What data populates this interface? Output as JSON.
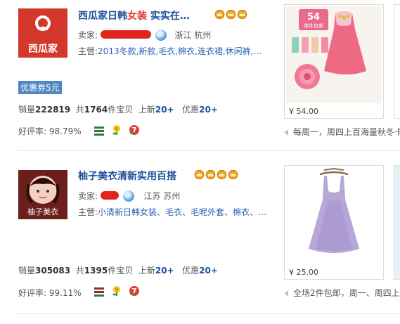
{
  "shops": [
    {
      "name_prefix": "西瓜家日韩",
      "name_highlight": "女装",
      "name_suffix": " 实实在…",
      "logo_text": "西瓜家",
      "crowns": 3,
      "seller_label": "卖家:",
      "location": "浙江 杭州",
      "main_label": "主营:",
      "main_items": "2013冬款,新款,毛衣,棉衣,连衣裙,休闲裤,…",
      "coupon": "优惠券5元",
      "sales_label": "销量",
      "sales_value": "222819",
      "total_prefix": "共",
      "total_value": "1764",
      "total_suffix": "件宝贝",
      "new_label": "上新",
      "new_value": "20+",
      "discount_label": "优惠",
      "discount_value": "20+",
      "rating_label": "好评率:",
      "rating_value": "98.79%",
      "product_price": "¥ 54.00",
      "product_badge_top": "54",
      "product_badge_unit": "元",
      "product_badge_bottom": "单件包邮",
      "notice": "每周一，周四上百海量秋冬卡"
    },
    {
      "name_prefix": "柚子美衣清新实用百搭",
      "name_highlight": "",
      "name_suffix": "",
      "logo_text": "柚子美衣",
      "crowns": 4,
      "seller_label": "卖家:",
      "location": "江苏 苏州",
      "main_label": "主营:",
      "main_items": "小清新日韩女装、毛衣、毛呢外套、棉衣、…",
      "sales_label": "销量",
      "sales_value": "305083",
      "total_prefix": "共",
      "total_value": "1395",
      "total_suffix": "件宝贝",
      "new_label": "上新",
      "new_value": "20+",
      "discount_label": "优惠",
      "discount_value": "20+",
      "rating_label": "好评率:",
      "rating_value": "99.11%",
      "product_price": "¥ 25.00",
      "notice": "全场2件包邮，周一、周四上"
    }
  ],
  "icons": {
    "crown": "crown-icon",
    "wangwang": "wangwang-icon",
    "consumer_protection": "bars-icon",
    "seven_day": "seven-day-return-icon",
    "flower": "flower-icon",
    "speaker": "speaker-icon"
  },
  "colors": {
    "shop_name": "#1a4f9c",
    "highlight": "#e4393c",
    "link": "#2a62b8",
    "coupon_bg": "#4f87c2"
  }
}
